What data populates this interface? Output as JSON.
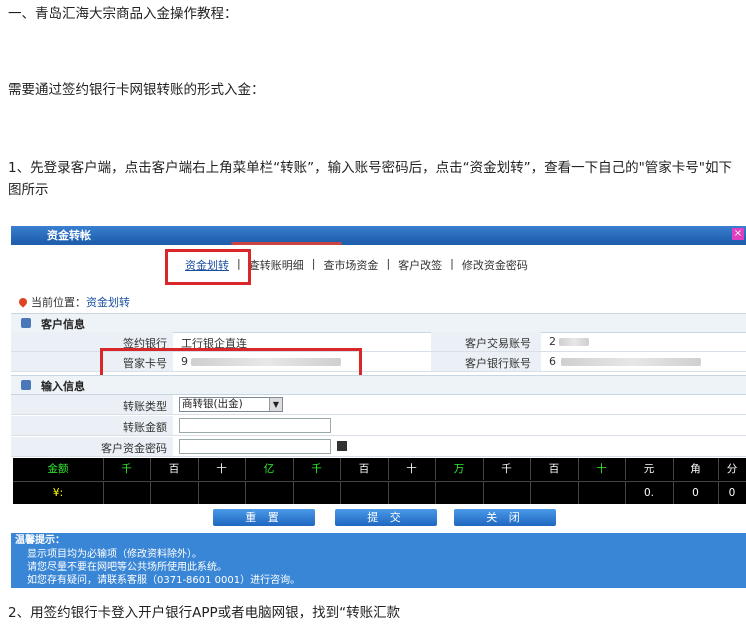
{
  "paragraphs": {
    "p1": "一、青岛汇海大宗商品入金操作教程：",
    "p2": "需要通过签约银行卡网银转账的形式入金：",
    "p3": "1、先登录客户端，点击客户端右上角菜单栏“转账”，输入账号密码后，点击“资金划转”，查看一下自己的\"管家卡号\"如下图所示",
    "p4": "2、用签约银行卡登入开户银行APP或者电脑网银，找到“转账汇款"
  },
  "window": {
    "title": "资金转帐",
    "close": "×"
  },
  "tabs": [
    "资金划转",
    "查转账明细",
    "查市场资金",
    "客户改签",
    "修改资金密码"
  ],
  "tab_sep": "|",
  "location": {
    "label": "当前位置：",
    "value": "资金划转"
  },
  "customer_section": {
    "title": "客户信息",
    "rows": [
      {
        "l1": "签约银行",
        "v1": "工行银企直连",
        "l2": "客户交易账号",
        "v2": "2"
      },
      {
        "l1": "管家卡号",
        "v1": "9",
        "l2": "客户银行账号",
        "v2": "6"
      }
    ]
  },
  "input_section": {
    "title": "输入信息",
    "transfer_type_label": "转账类型",
    "transfer_type_value": "商转银(出金)",
    "amount_label": "转账金额",
    "password_label": "客户资金密码"
  },
  "amount_grid": {
    "header": [
      "金额",
      "千",
      "百",
      "十",
      "亿",
      "千",
      "百",
      "十",
      "万",
      "千",
      "百",
      "十",
      "元",
      "角",
      "分"
    ],
    "values": [
      "¥:",
      "",
      "",
      "",
      "",
      "",
      "",
      "",
      "",
      "",
      "",
      "",
      "0.",
      "0",
      "0"
    ]
  },
  "buttons": {
    "reset": "重 置",
    "submit": "提 交",
    "close": "关 闭"
  },
  "tips": {
    "title": "温馨提示：",
    "lines": [
      "显示项目均为必输项（修改资料除外）。",
      "请您尽量不要在网吧等公共场所使用此系统。",
      "如您存有疑问，请联系客服（0371-8601 0001）进行咨询。"
    ]
  }
}
